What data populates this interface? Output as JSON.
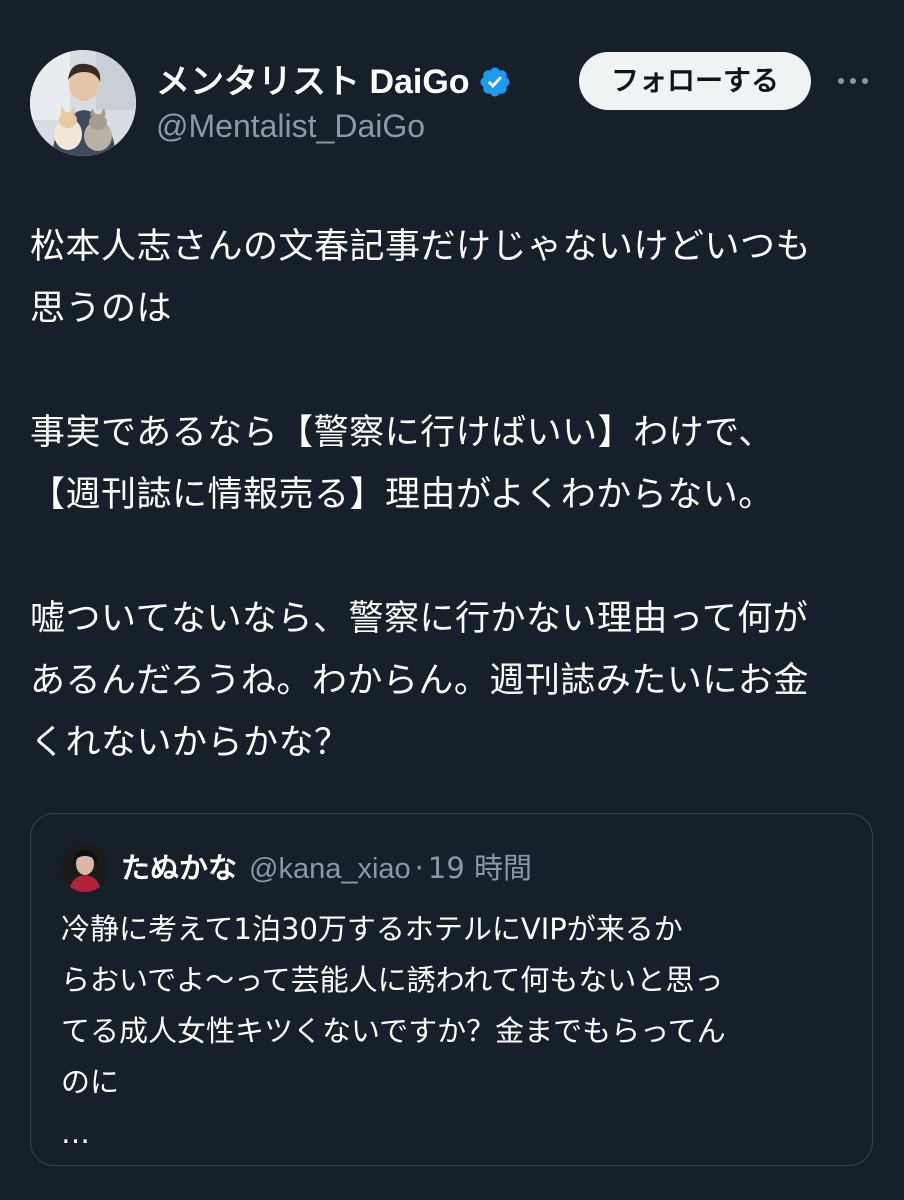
{
  "author": {
    "display_name": "メンタリスト DaiGo",
    "handle": "@Mentalist_DaiGo",
    "avatar_icon": "profile-photo-with-cats",
    "verified_icon": "verified-badge-icon"
  },
  "follow_button_label": "フォローする",
  "more_icon": "more-options-icon",
  "tweet": {
    "line1": "松本人志さんの文春記事だけじゃないけどいつも",
    "line2": "思うのは",
    "line3": "事実であるなら【警察に行けばいい】わけで、",
    "line4": "【週刊誌に情報売る】理由がよくわからない。",
    "line5": "嘘ついてないなら、警察に行かない理由って何が",
    "line6": "あるんだろうね。わからん。週刊誌みたいにお金",
    "line7": "くれないからかな？"
  },
  "quote": {
    "display_name": "たぬかな",
    "handle": "@kana_xiao",
    "separator": "·",
    "time": "19 時間",
    "line1": "冷静に考えて1泊30万するホテルにVIPが来るか",
    "line2": "らおいでよ〜って芸能人に誘われて何もないと思っ",
    "line3": "てる成人女性キツくないですか？金までもらってん",
    "line4": "のに",
    "line5": "…"
  },
  "colors": {
    "background": "#15202b",
    "verified": "#1d9bf0",
    "secondary_text": "#8b98a5",
    "border": "#38444d"
  }
}
